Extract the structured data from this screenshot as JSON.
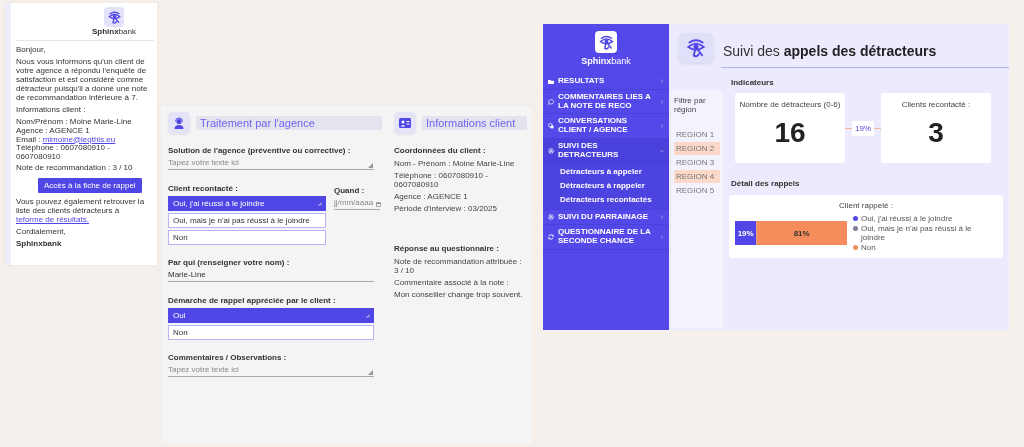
{
  "email": {
    "brand": "**Sphinx**bank",
    "greeting": "Bonjour,",
    "body": "Nous vous informons qu'un client de votre agence a répondu l'enquête de satisfaction et est considéré comme détracteur puisqu'il a donné une note de recommandation inférieure à 7.",
    "info_heading": "Informations client :",
    "info_lines": [
      {
        "kind": "text",
        "text": "Nom/Prénom : Moine Marie-Line"
      },
      {
        "kind": "text",
        "text": "Agence : AGENCE 1"
      },
      {
        "kind": "email",
        "label": "Email :",
        "text": "mlmoine@leqthis.eu"
      },
      {
        "kind": "text",
        "text": "Téléphone : 0607080910 - 0607080910"
      }
    ],
    "score": "Note de recommandation : 3 / 10",
    "button": "Accès à la fiche de rappel",
    "footer": "Vous pouvez également retrouver la liste des clients détracteurs à",
    "footer_link": "teforme de résultats.",
    "closing": "Cordialement,",
    "signature": "Sphinxbank"
  },
  "agency_form": {
    "title": "Traitement par l'agence",
    "fields": [
      {
        "kind": "textarea",
        "label": "Solution de l'agence (préventive ou corrective) :",
        "placeholder": "Tapez votre texte ici"
      },
      {
        "kind": "choice",
        "label": "Client recontacté :",
        "options": [
          {
            "label": "Oui, j'ai réussi à le joindre",
            "selected": true
          },
          {
            "label": "Oui, mais je n'ai pas réussi à le joindre",
            "selected": false
          },
          {
            "label": "Non",
            "selected": false
          }
        ],
        "side_field": {
          "label": "Quand :",
          "placeholder": "jj/mm/aaaa"
        }
      },
      {
        "kind": "text",
        "label": "Par qui (renseigner votre nom) :",
        "value": "Marie-Line"
      },
      {
        "kind": "choice",
        "label": "Démarche de rappel appréciée par le client :",
        "options": [
          {
            "label": "Oui",
            "selected": true
          },
          {
            "label": "Non",
            "selected": false
          }
        ]
      },
      {
        "kind": "textarea",
        "label": "Commentaires / Observations :",
        "placeholder": "Tapez votre texte ici"
      }
    ]
  },
  "client_info": {
    "title": "Informations client",
    "sections": [
      {
        "heading": "Coordonnées du client :",
        "lines": [
          "Nom - Prénom : Moine Marie-Line",
          "Téléphone : 0607080910 - 0607080910",
          "Agence : AGENCE 1",
          "Période d'interview : 03/2025"
        ]
      },
      {
        "heading": "Réponse au questionnaire :",
        "lines": [
          "Note de recommandation attribuée : 3 / 10",
          "Commentaire associé à la note :",
          "Mon conseiller change trop souvent."
        ]
      }
    ]
  },
  "dashboard": {
    "brand": "**Sphinx**bank",
    "menu": [
      {
        "label": "RESULTATS",
        "expanded": false
      },
      {
        "label": "COMMENTAIRES LIES A LA NOTE DE RECO",
        "expanded": false
      },
      {
        "label": "CONVERSATIONS CLIENT / AGENCE",
        "expanded": false
      },
      {
        "label": "SUIVI DES DETRACTEURS",
        "expanded": true,
        "children": [
          {
            "label": "Détracteurs à appeler"
          },
          {
            "label": "Détracteurs à rappeler"
          },
          {
            "label": "Détracteurs recontactés"
          }
        ]
      },
      {
        "label": "SUIVI DU PARRAINAGE",
        "expanded": false
      },
      {
        "label": "QUESTIONNAIRE DE LA SECONDE CHANCE",
        "expanded": false
      }
    ],
    "title": "Suivi des **appels des détracteurs**",
    "filter": {
      "label": "Filtre par région",
      "regions": [
        {
          "label": "REGION 1",
          "selected": false
        },
        {
          "label": "REGION 2",
          "selected": true
        },
        {
          "label": "REGION 3",
          "selected": false
        },
        {
          "label": "REGION 4",
          "selected": true
        },
        {
          "label": "REGION 5",
          "selected": false
        }
      ]
    },
    "indicators_heading": "Indicateurs",
    "indicators": [
      {
        "label": "Nombre de détracteurs (0-6)",
        "value": "16"
      },
      {
        "label": "Clients recontacté :",
        "value": "3"
      }
    ],
    "ratio": "19%",
    "details_heading": "Détail des rappels",
    "chart": {
      "chart_data": {
        "type": "bar",
        "orientation": "horizontal",
        "stacked": true,
        "legend": "right",
        "title": "Client rappelé :",
        "series": [
          {
            "name": "Oui, j'ai réussi à le joindre",
            "color": "#5046e5",
            "values": [
              19
            ],
            "value_labels": [
              "19%"
            ]
          },
          {
            "name": "Oui, mais je n'ai pas réussi à le joindre",
            "color": "#7d7f95",
            "values": [
              0
            ],
            "value_labels": [
              null
            ]
          },
          {
            "name": "Non",
            "color": "#f58c5c",
            "values": [
              81
            ],
            "value_labels": [
              "81%"
            ]
          }
        ]
      }
    }
  }
}
